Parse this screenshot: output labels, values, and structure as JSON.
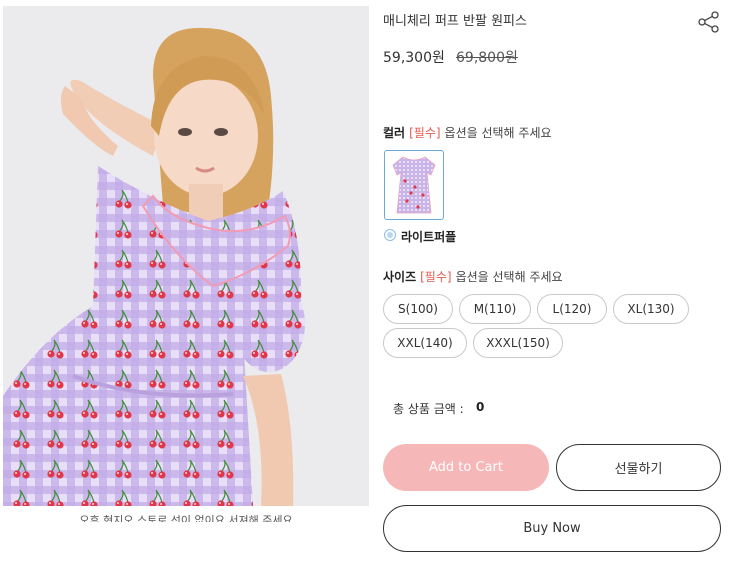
{
  "product": {
    "title": "매니체리 퍼프 반팔 원피스",
    "price": "59,300원",
    "original_price": "69,800원"
  },
  "image_caption": "오후 현지오 스토로 선이 없이요 서져해 주세요",
  "color_option": {
    "label": "컬러",
    "required": "[필수]",
    "hint": "옵션을 선택해 주세요",
    "selected": "라이트퍼플"
  },
  "size_option": {
    "label": "사이즈",
    "required": "[필수]",
    "hint": "옵션을 선택해 주세요",
    "sizes": [
      "S(100)",
      "M(110)",
      "L(120)",
      "XL(130)",
      "XXL(140)",
      "XXXL(150)"
    ]
  },
  "total": {
    "label": "총 상품 금액 :",
    "value": "0"
  },
  "buttons": {
    "add_to_cart": "Add to Cart",
    "gift": "선물하기",
    "buy_now": "Buy Now"
  },
  "icons": {
    "share": "share-icon",
    "radio": "radio-icon"
  },
  "colors": {
    "cart_button": "#f5b7b8",
    "required_text": "#e45a4f",
    "swatch_border": "#6aa9d8",
    "dress_lavender": "#c8b3e8",
    "cherry_red": "#e0384a"
  }
}
